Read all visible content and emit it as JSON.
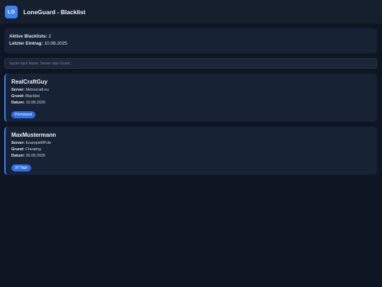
{
  "header": {
    "logo_text": "LG",
    "title": "LoneGuard - Blacklist"
  },
  "stats": {
    "active_label": "Aktive Blacklists:",
    "active_value": "2",
    "last_label": "Letzter Eintrag:",
    "last_value": "10.08.2025"
  },
  "search": {
    "placeholder": "Suche nach Name, Server oder Grund..."
  },
  "labels": {
    "server": "Server:",
    "reason": "Grund:",
    "date": "Datum:"
  },
  "entries": [
    {
      "name": "RealCraftGuy",
      "server": "Metrocraft.eu",
      "reason": "Blacklist",
      "date": "10.08.2025",
      "badge": "Permanent"
    },
    {
      "name": "MaxMustermann",
      "server": "ExampleRP.de",
      "reason": "Cheating",
      "date": "09.08.2025",
      "badge": "30 Tage"
    }
  ],
  "colors": {
    "accent": "#3b82f6",
    "badge": "#2f6fe8",
    "background": "#0e1624",
    "card": "#172235"
  }
}
